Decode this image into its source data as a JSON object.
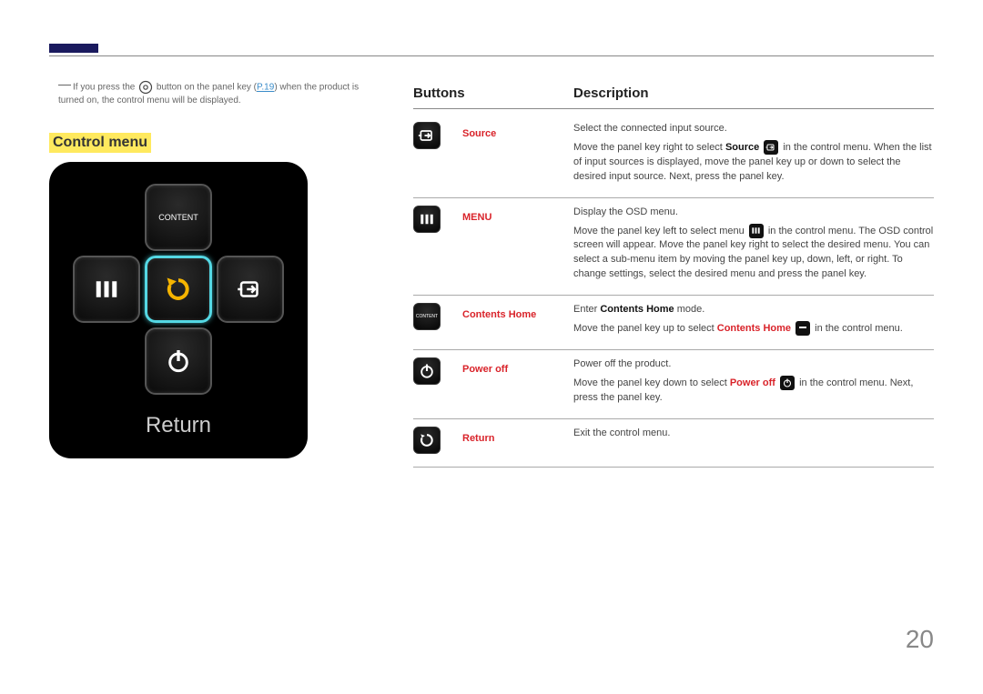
{
  "note": {
    "pre": "If you press the ",
    "mid1": " button on the panel key (",
    "link": "P.19",
    "mid2": ") when the product is turned on, the control menu will be displayed."
  },
  "section_heading": "Control menu",
  "panel": {
    "content_label": "CONTENT",
    "return_label": "Return"
  },
  "table": {
    "header_buttons": "Buttons",
    "header_desc": "Description",
    "rows": [
      {
        "name": "Source",
        "line1_pre": "Select the connected input source.",
        "line2_a": "Move the panel key right to select ",
        "line2_bold": "Source",
        "line2_b": " in the control menu. When the list of input sources is displayed, move the panel key up or down to select the desired input source. Next, press the panel key."
      },
      {
        "name": "MENU",
        "line1_pre": "Display the OSD menu.",
        "line2_a": "Move the panel key left to select menu ",
        "line2_b": " in the control menu. The OSD control screen will appear. Move the panel key right to select the desired menu. You can select a sub-menu item by moving the panel key up, down, left, or right. To change settings, select the desired menu and press the panel key."
      },
      {
        "name": "Contents Home",
        "line1_a": "Enter ",
        "line1_bold": "Contents Home",
        "line1_b": " mode.",
        "line2_a": "Move the panel key up to select ",
        "line2_bold": "Contents Home",
        "line2_b": " in the control menu."
      },
      {
        "name": "Power off",
        "line1_pre": "Power off the product.",
        "line2_a": "Move the panel key down to select ",
        "line2_bold": "Power off",
        "line2_b": " in the control menu. Next, press the panel key."
      },
      {
        "name": "Return",
        "line1_pre": "Exit the control menu."
      }
    ]
  },
  "page_number": "20"
}
